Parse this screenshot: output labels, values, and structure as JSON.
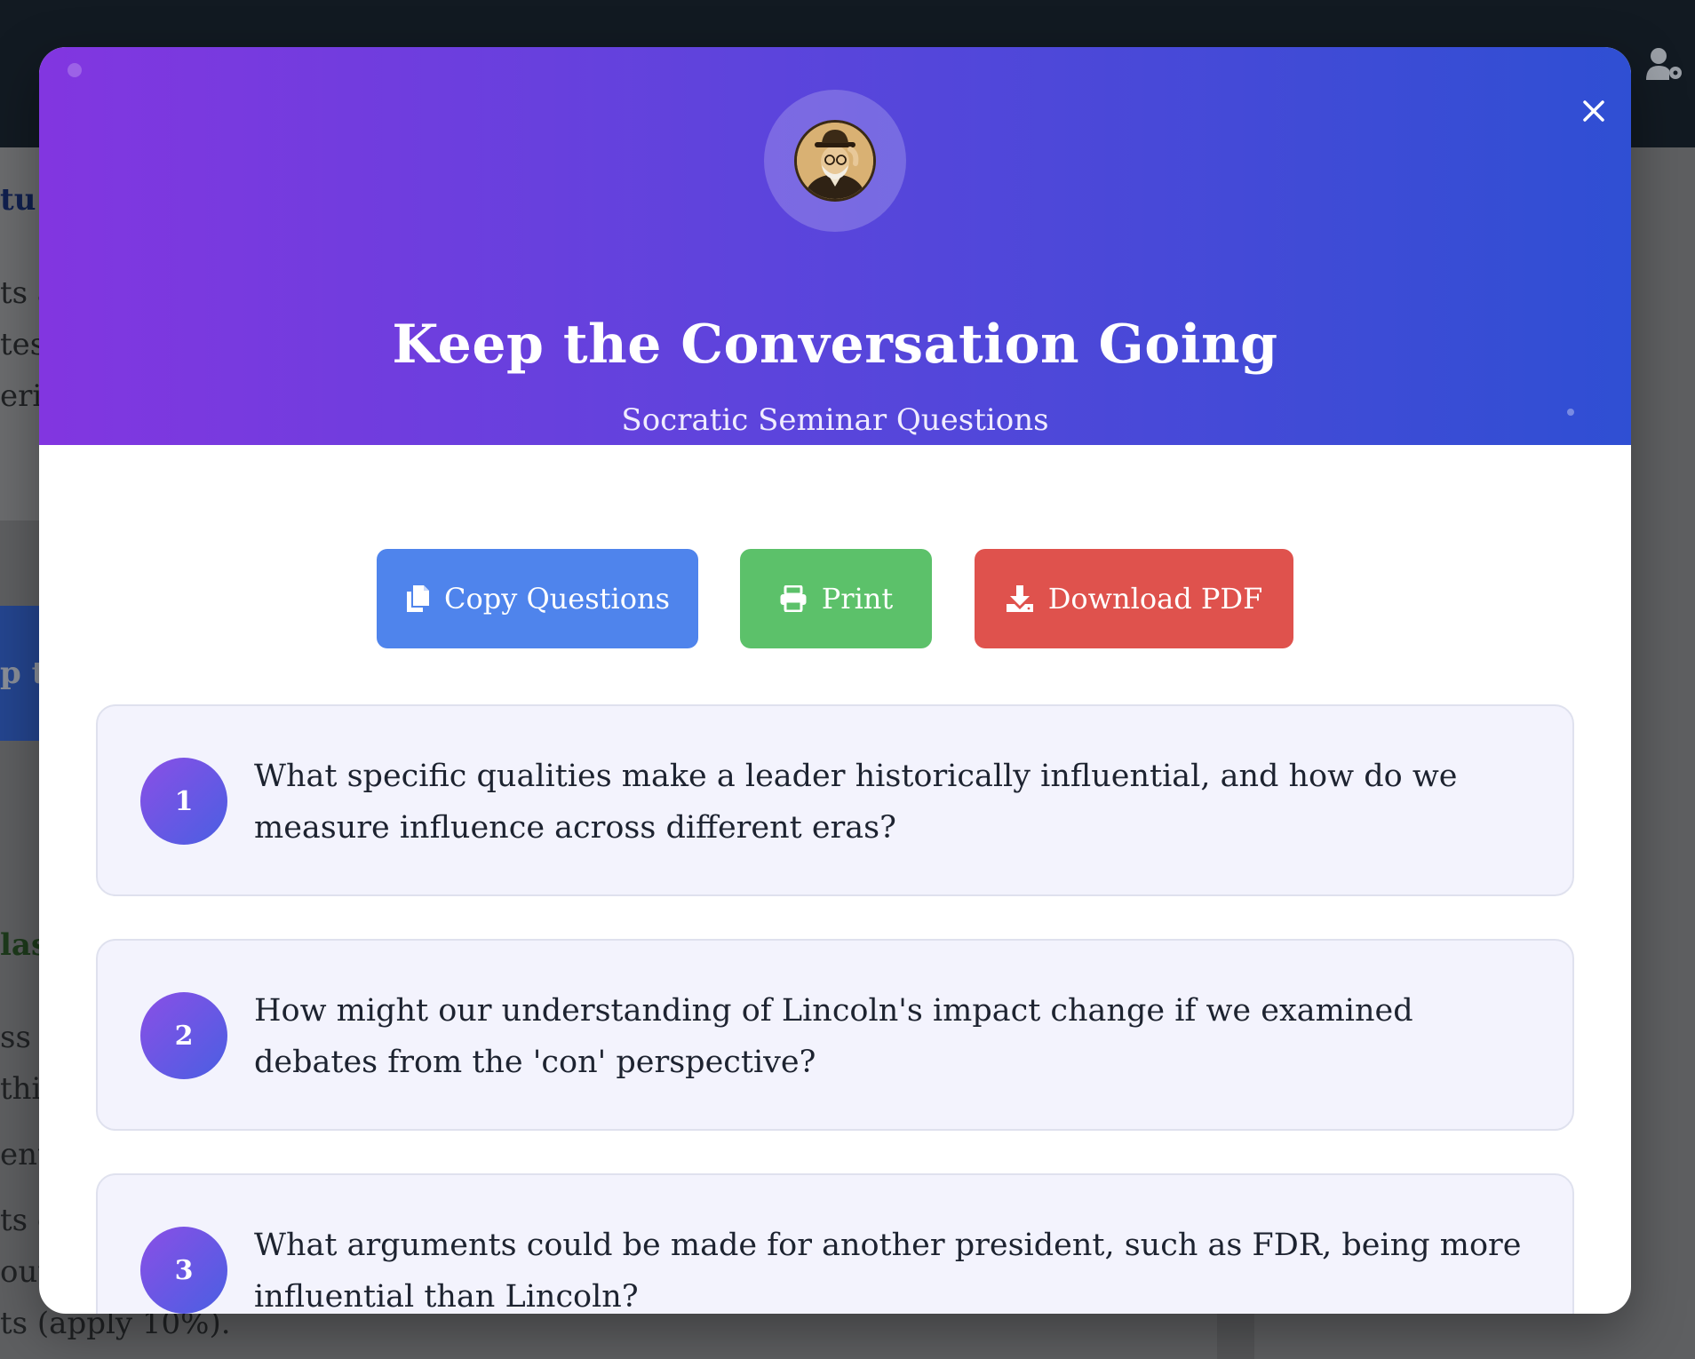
{
  "background": {
    "fragments": [
      {
        "text": "tu",
        "style": "heading"
      },
      {
        "text": "ts a",
        "style": "body"
      },
      {
        "text": "tes",
        "style": "body"
      },
      {
        "text": "erin",
        "style": "body"
      },
      {
        "text": "p tl",
        "style": "banner"
      },
      {
        "text": "las",
        "style": "heading-green"
      },
      {
        "text": "ss c",
        "style": "body"
      },
      {
        "text": "thi",
        "style": "body"
      },
      {
        "text": "ent",
        "style": "body"
      },
      {
        "text": "ts e",
        "style": "body"
      },
      {
        "text": "out",
        "style": "body"
      },
      {
        "text": "ts (apply 10%).",
        "style": "body"
      }
    ]
  },
  "topbar": {
    "icon": "user-gear-icon"
  },
  "modal": {
    "title": "Keep the Conversation Going",
    "subtitle": "Socratic Seminar Questions",
    "close_icon": "close-icon",
    "avatar_icon": "avatar"
  },
  "actions": {
    "copy_label": "Copy Questions",
    "print_label": "Print",
    "pdf_label": "Download PDF",
    "colors": {
      "copy": "#4f84ec",
      "print": "#5cc16a",
      "pdf": "#df524d"
    }
  },
  "questions": [
    {
      "number": "1",
      "text": "What specific qualities make a leader historically influential, and how do we measure influence across different eras?"
    },
    {
      "number": "2",
      "text": "How might our understanding of Lincoln's impact change if we examined debates from the 'con' perspective?"
    },
    {
      "number": "3",
      "text": "What arguments could be made for another president, such as FDR, being more influential than Lincoln?"
    }
  ],
  "colors": {
    "header_gradient_start": "#8236e0",
    "header_gradient_end": "#2f4fd3",
    "card_background": "#f3f3fd"
  }
}
